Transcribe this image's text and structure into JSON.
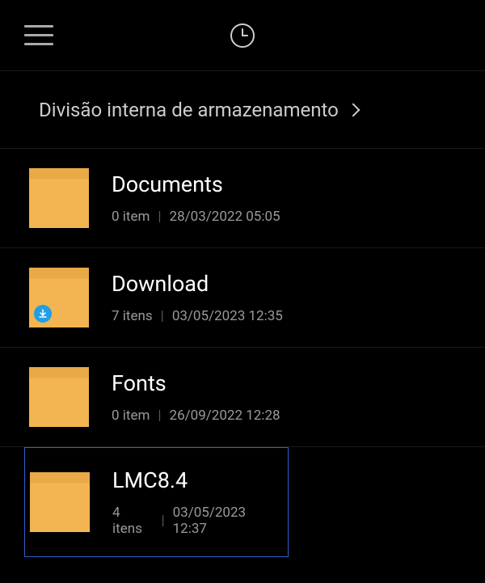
{
  "breadcrumb": {
    "label": "Divisão interna de armazenamento"
  },
  "items": [
    {
      "name": "Documents",
      "count": "0 item",
      "date": "28/03/2022 05:05",
      "badge": null,
      "selected": false
    },
    {
      "name": "Download",
      "count": "7 itens",
      "date": "03/05/2023 12:35",
      "badge": "download",
      "selected": false
    },
    {
      "name": "Fonts",
      "count": "0 item",
      "date": "26/09/2022 12:28",
      "badge": null,
      "selected": false
    },
    {
      "name": "LMC8.4",
      "count": "4 itens",
      "date": "03/05/2023 12:37",
      "badge": null,
      "selected": true
    }
  ]
}
